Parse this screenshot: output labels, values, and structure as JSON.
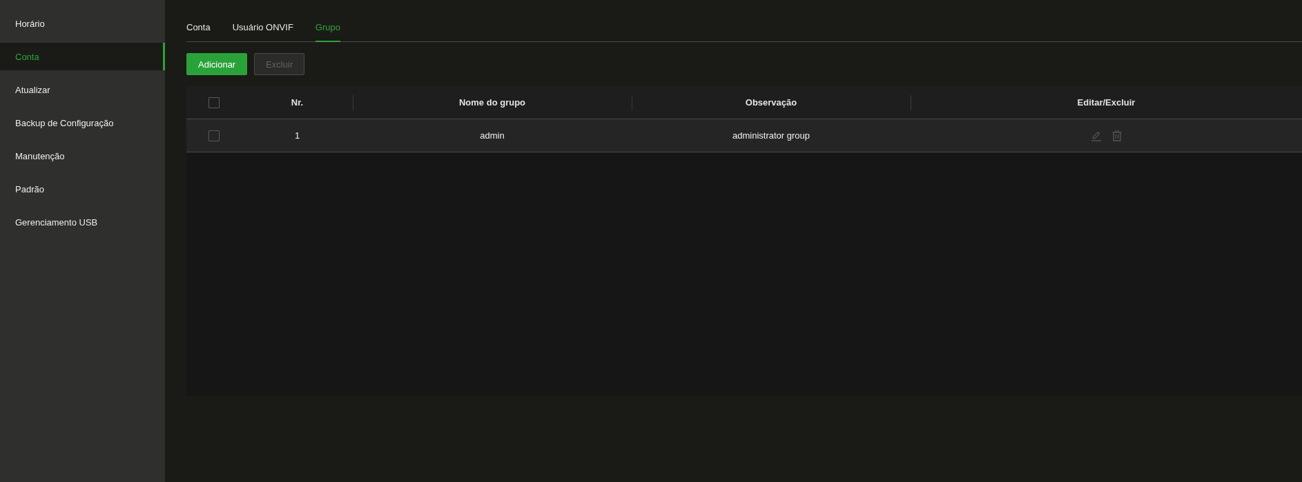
{
  "sidebar": {
    "items": [
      {
        "label": "Horário",
        "selected": false
      },
      {
        "label": "Conta",
        "selected": true
      },
      {
        "label": "Atualizar",
        "selected": false
      },
      {
        "label": "Backup de Configuração",
        "selected": false
      },
      {
        "label": "Manutenção",
        "selected": false
      },
      {
        "label": "Padrão",
        "selected": false
      },
      {
        "label": "Gerenciamento USB",
        "selected": false
      }
    ]
  },
  "tabs": [
    {
      "label": "Conta",
      "selected": false
    },
    {
      "label": "Usuário ONVIF",
      "selected": false
    },
    {
      "label": "Grupo",
      "selected": true
    }
  ],
  "toolbar": {
    "buttons": [
      {
        "label": "Adicionar",
        "kind": "primary",
        "disabled": false
      },
      {
        "label": "Excluir",
        "kind": "default",
        "disabled": true
      }
    ]
  },
  "table": {
    "select_all": {
      "checked": false
    },
    "columns": [
      "Nr.",
      "Nome do grupo",
      "Observação",
      "Editar/Excluir"
    ],
    "rows": [
      {
        "checked": false,
        "cells": [
          "1",
          "admin",
          "administrator group"
        ],
        "actions_disabled": true
      }
    ]
  }
}
